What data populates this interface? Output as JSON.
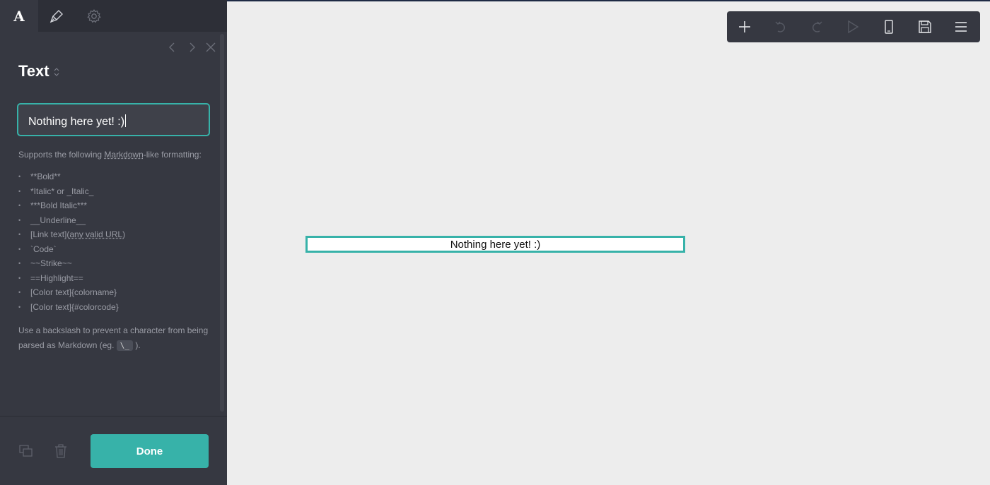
{
  "sidebar": {
    "tabs": [
      {
        "label": "A",
        "icon": "text-icon"
      },
      {
        "icon": "brush-icon"
      },
      {
        "icon": "gear-icon"
      }
    ],
    "nav_icons": [
      "chevron-left-icon",
      "chevron-right-icon",
      "close-icon"
    ],
    "panel_title": "Text",
    "input_value": "Nothing here yet! :)",
    "help_prefix": "Supports the following ",
    "help_link": "Markdown",
    "help_suffix": "-like formatting:",
    "format_items": [
      "**Bold**",
      "*Italic* or _Italic_",
      "***Bold Italic***",
      "__Underline__",
      "[Link text](",
      "`Code`",
      "~~Strike~~",
      "==Highlight==",
      "[Color text]{colorname}",
      "[Color text]{#colorcode}"
    ],
    "link_url_text": "any valid URL",
    "link_close": ")",
    "help2_text": "Use a backslash to prevent a character from being parsed as Markdown (eg. ",
    "help2_code": "\\_",
    "help2_end": " ).",
    "footer": {
      "done_label": "Done",
      "icons": [
        "duplicate-icon",
        "trash-icon"
      ]
    }
  },
  "toolbar": {
    "buttons": [
      "plus-icon",
      "undo-icon",
      "redo-icon",
      "play-icon",
      "mobile-icon",
      "save-icon",
      "menu-icon"
    ]
  },
  "canvas": {
    "text_block": "Nothing here yet! :)"
  },
  "colors": {
    "accent": "#37b2a9",
    "sidebar_bg": "#363841",
    "canvas_bg": "#ededed"
  }
}
